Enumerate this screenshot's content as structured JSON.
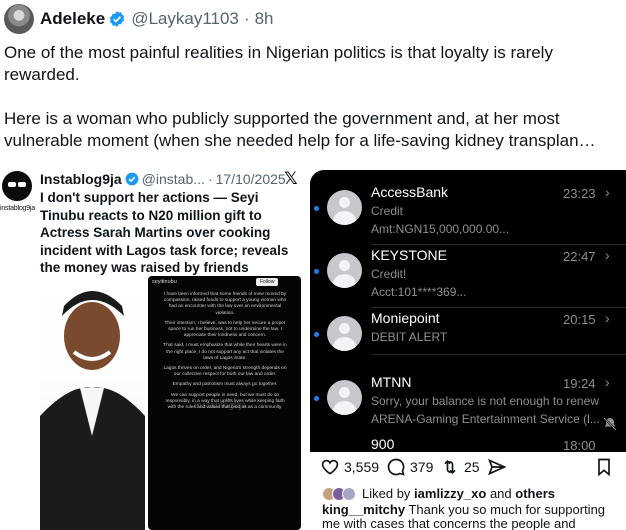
{
  "header": {
    "display_name": "Adeleke",
    "handle": "@Laykay1103",
    "separator": "·",
    "time": "8h"
  },
  "tweet": {
    "line1": "One of the most painful realities in Nigerian politics is that loyalty is rarely rewarded.",
    "line2": "Here is a woman who publicly supported the government and, at her most vulnerable moment (when she needed help for a life-saving kidney transplan…"
  },
  "embed": {
    "logo_label": "instablog9ja",
    "name": "Instablog9ja",
    "handle": "@instab...",
    "separator": "·",
    "date": "17/10/2025",
    "x_mark": "𝕏",
    "title": "I don't support her actions — Seyi Tinubu reacts to N20 million gift to Actress Sarah Martins over cooking incident with Lagos task force; reveals the money was raised by friends",
    "ig_user": "seyitinubu",
    "ig_follow": "Follow",
    "ig_watermark": "instablog9ja",
    "ig_paragraphs": [
      "I have been informed that some friends of mine moved by compassion, raised funds to support a young woman who had an encounter with the law over an environmental violation.",
      "Their intention, I believe, was to help her secure a proper space to run her business, not to undermine the law. I appreciate their kindness and concern.",
      "That said, I must emphasize that while their hearts were in the right place, I do not support any act that violates the laws of Lagos State.",
      "Lagos thrives on order, and Nigeria's strength depends on our collective respect for both our law and order.",
      "Empathy and patriotism must always go together.",
      "We can support people in need, but we must do so responsibly, in a way that uplifts lives while keeping faith with the rules and values that bind us as a community."
    ]
  },
  "notifications": [
    {
      "sender": "AccessBank",
      "time": "23:23",
      "line1": "Credit",
      "line2": "Amt:NGN15,000,000.00..."
    },
    {
      "sender": "KEYSTONE",
      "time": "22:47",
      "line1": "Credit!",
      "line2": "Acct:101****369..."
    },
    {
      "sender": "Moniepoint",
      "time": "20:15",
      "line1": "DEBIT ALERT",
      "line2": ""
    },
    {
      "sender": "MTNN",
      "time": "19:24",
      "line1": "Sorry, your balance is not enough to renew",
      "line2": "ARENA-Gaming Entertainment Service (l..."
    },
    {
      "sender": "900",
      "time": "18:00",
      "line1": "",
      "line2": ""
    }
  ],
  "actions": {
    "likes": "3,559",
    "retweets_or_replies": "379",
    "reposts": "25"
  },
  "liked_by": {
    "prefix": "Liked by",
    "user": "iamlizzy_xo",
    "suffix": "and",
    "others": "others"
  },
  "comment": {
    "user": "king__mitchy",
    "text": "Thank you so much for supporting me with cases that concerns the people and reaching out"
  },
  "colors": {
    "verified": "#1d9bf0",
    "unread_dot": "#1d7ff0",
    "phone_bg": "#000000"
  }
}
